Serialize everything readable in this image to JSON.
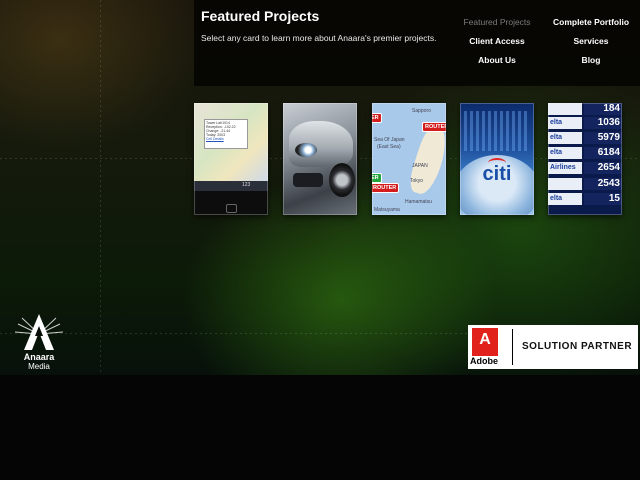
{
  "header": {
    "title": "Featured Projects",
    "subtitle": "Select any card to learn more about Anaara's premier projects."
  },
  "nav": {
    "featured_projects": "Featured Projects",
    "complete_portfolio": "Complete Portfolio",
    "client_access": "Client Access",
    "services": "Services",
    "about_us": "About Us",
    "blog": "Blog",
    "active_item": "Featured Projects"
  },
  "cards": {
    "map_app": {
      "bubble_lines": [
        "Tower Lat/1014",
        "Reception: -102.22",
        "Change: -21.44",
        "Today: 2003",
        "Cell Details"
      ],
      "toolbar": "123"
    },
    "japan_map": {
      "labels": [
        "Sapporo",
        "Sea Of Japan",
        "(East Sea)",
        "JAPAN",
        "Tokyo",
        "Hamamatsu",
        "Matsuyama"
      ],
      "router_tags": [
        "ROUTER",
        "ROUTER"
      ],
      "green_tag": "ER",
      "red_tag_left": "ER"
    },
    "citi": {
      "logo": "citi"
    },
    "airline_board": {
      "rows": [
        {
          "left": "",
          "right": "184"
        },
        {
          "left": "elta",
          "right": "1036"
        },
        {
          "left": "elta",
          "right": "5979"
        },
        {
          "left": "elta",
          "right": "6184"
        },
        {
          "left": "Airlines",
          "right": "2654"
        },
        {
          "left": "",
          "right": "2543"
        },
        {
          "left": "elta",
          "right": "15"
        }
      ]
    }
  },
  "branding": {
    "company": "Anaara",
    "tagline": "Media"
  },
  "partner": {
    "adobe_mark": "A",
    "adobe_wordmark": "Adobe",
    "label": "SOLUTION PARTNER"
  },
  "colors": {
    "accent_red": "#d31d1d",
    "nav_active": "#7a7a7a",
    "citi_blue": "#1a4fa8"
  }
}
